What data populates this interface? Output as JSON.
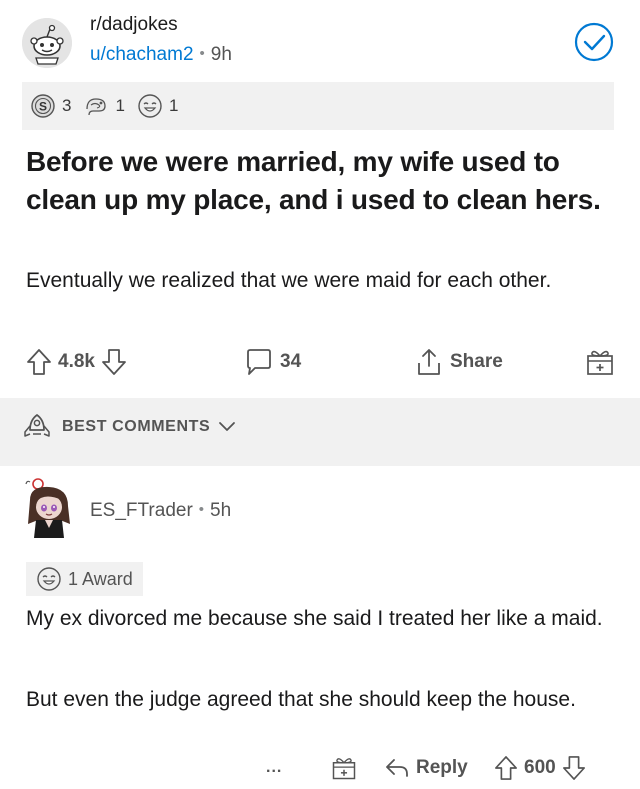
{
  "post": {
    "subreddit": "r/dadjokes",
    "author": "u/chacham2",
    "age": "9h",
    "awards": [
      {
        "icon": "silver-award-icon",
        "count": "3"
      },
      {
        "icon": "helpful-award-icon",
        "count": "1"
      },
      {
        "icon": "wholesome-award-icon",
        "count": "1"
      }
    ],
    "title": "Before we were married, my wife used to clean up my place, and i used to clean hers.",
    "body": "Eventually we realized that we were maid for each other.",
    "upvotes": "4.8k",
    "comments": "34",
    "share_label": "Share"
  },
  "comments_sort": {
    "label": "BEST COMMENTS"
  },
  "comment": {
    "author": "ES_FTrader",
    "age": "5h",
    "award_label": "1 Award",
    "paragraphs": [
      "My ex divorced me because she said I treated her like a maid.",
      "But even the judge agreed that she should keep the house."
    ],
    "more_label": "...",
    "reply_label": "Reply",
    "score": "600"
  },
  "colors": {
    "link_blue": "#0079d3",
    "gray_band": "#f1f1f1",
    "text": "#1a1a1b",
    "muted": "#545454"
  }
}
